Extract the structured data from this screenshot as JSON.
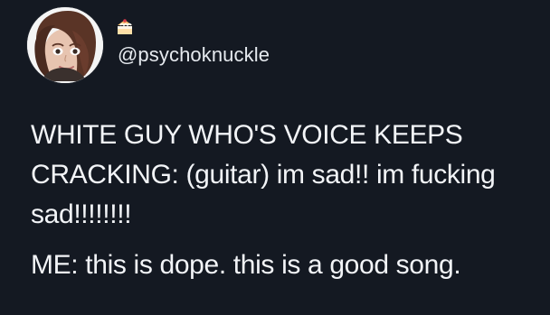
{
  "tweet": {
    "handle": "@psychoknuckle",
    "emoji_icon": "cake-icon",
    "avatar_icon": "avatar-portrait-icon",
    "paragraphs": [
      "WHITE GUY WHO'S VOICE KEEPS CRACKING: (guitar) im sad!! im fucking sad!!!!!!!!",
      "ME: this is dope. this is a good song."
    ]
  }
}
